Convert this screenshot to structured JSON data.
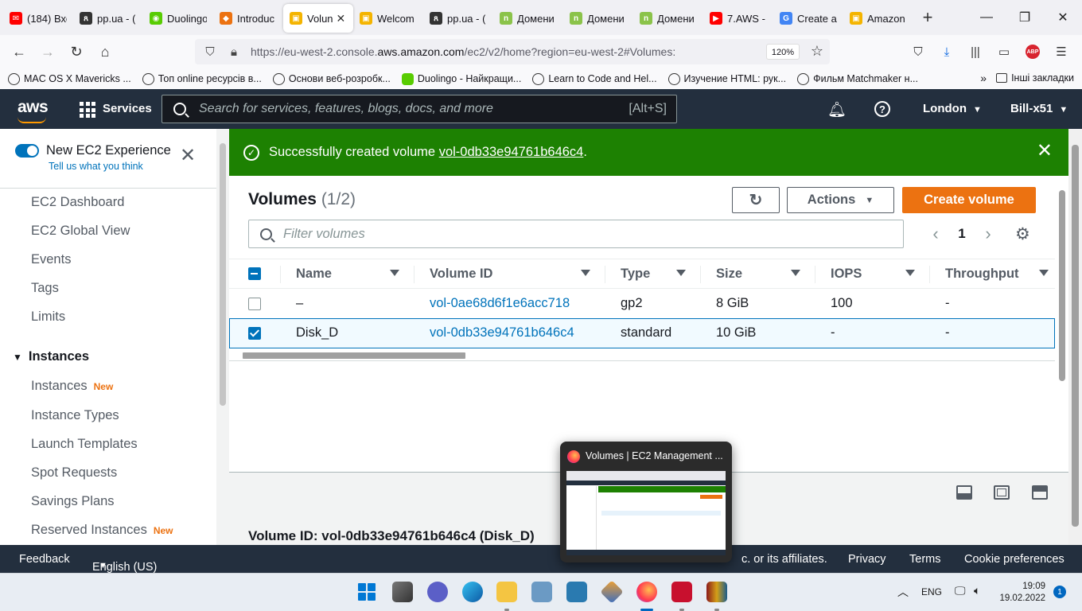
{
  "browser": {
    "tabs": [
      {
        "title": "(184) Вхо",
        "color": "#ff0000",
        "glyph": "✉"
      },
      {
        "title": "pp.ua - (",
        "color": "#333333",
        "glyph": "ጸ"
      },
      {
        "title": "Duolingo",
        "color": "#58cc02",
        "glyph": "◉"
      },
      {
        "title": "Introduc",
        "color": "#ec7211",
        "glyph": "◆"
      },
      {
        "title": "Volun",
        "color": "#f4b400",
        "glyph": "▣",
        "active": true
      },
      {
        "title": "Welcom",
        "color": "#f4b400",
        "glyph": "▣"
      },
      {
        "title": "pp.ua - (",
        "color": "#333333",
        "glyph": "ጸ"
      },
      {
        "title": "Домени",
        "color": "#8bc34a",
        "glyph": "n"
      },
      {
        "title": "Домени",
        "color": "#8bc34a",
        "glyph": "n"
      },
      {
        "title": "Домени",
        "color": "#8bc34a",
        "glyph": "n"
      },
      {
        "title": "7.AWS -",
        "color": "#ff0000",
        "glyph": "▶"
      },
      {
        "title": "Create a",
        "color": "#4285f4",
        "glyph": "G"
      },
      {
        "title": "Amazon",
        "color": "#f4b400",
        "glyph": "▣"
      }
    ],
    "url_prefix": "https://eu-west-2.console.",
    "url_domain": "aws.amazon.com",
    "url_suffix": "/ec2/v2/home?region=eu-west-2#Volumes:",
    "zoom": "120%",
    "abp": "ABP"
  },
  "bookmarks": {
    "items": [
      "MAC OS X Mavericks ...",
      "Топ online ресурсів в...",
      "Основи веб-розробк...",
      "Duolingo - Найкращи...",
      "Learn to Code and Hel...",
      "Изучение HTML: рук...",
      "Фильм Matchmaker н..."
    ],
    "other": "Інші закладки"
  },
  "aws": {
    "logo": "aws",
    "services": "Services",
    "search_placeholder": "Search for services, features, blogs, docs, and more",
    "search_shortcut": "[Alt+S]",
    "region": "London",
    "account": "Bill-x51"
  },
  "sidebar": {
    "toggle_title": "New EC2 Experience",
    "toggle_sub": "Tell us what you think",
    "items": [
      "EC2 Dashboard",
      "EC2 Global View",
      "Events",
      "Tags",
      "Limits"
    ],
    "section_instances": "Instances",
    "instance_items": [
      "Instances",
      "Instance Types",
      "Launch Templates",
      "Spot Requests",
      "Savings Plans",
      "Reserved Instances"
    ],
    "new_badge": "New"
  },
  "flash": {
    "prefix": "Successfully created volume ",
    "volume_link": "vol-0db33e94761b646c4",
    "suffix": "."
  },
  "volumes": {
    "title": "Volumes",
    "count": "(1/2)",
    "actions_label": "Actions",
    "create_label": "Create volume",
    "filter_placeholder": "Filter volumes",
    "page": "1",
    "columns": [
      "Name",
      "Volume ID",
      "Type",
      "Size",
      "IOPS",
      "Throughput"
    ],
    "rows": [
      {
        "name": "–",
        "volume_id": "vol-0ae68d6f1e6acc718",
        "type": "gp2",
        "size": "8 GiB",
        "iops": "100",
        "throughput": "-",
        "selected": false
      },
      {
        "name": "Disk_D",
        "volume_id": "vol-0db33e94761b646c4",
        "type": "standard",
        "size": "10 GiB",
        "iops": "-",
        "throughput": "-",
        "selected": true
      }
    ]
  },
  "details": {
    "title": "Volume ID: vol-0db33e94761b646c4 (Disk_D)"
  },
  "footer": {
    "feedback": "Feedback",
    "language": "English (US)",
    "copyright": "c. or its affiliates.",
    "privacy": "Privacy",
    "terms": "Terms",
    "cookies": "Cookie preferences"
  },
  "taskbar_popup": {
    "title": "Volumes | EC2 Management ..."
  },
  "system": {
    "lang": "ENG",
    "time": "19:09",
    "date": "19.02.2022",
    "notifications": "1"
  }
}
